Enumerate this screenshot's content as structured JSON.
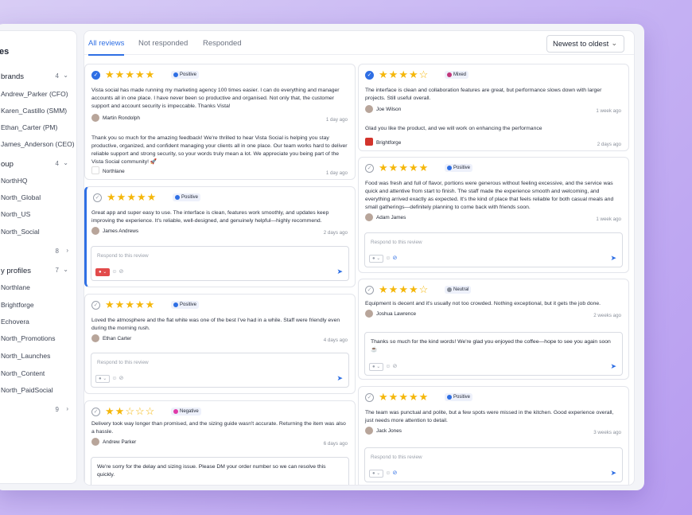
{
  "sidebar": {
    "title": "es",
    "rows": [
      {
        "label": "brands",
        "count": "4",
        "chev": "⌄",
        "head": true
      },
      {
        "label": "Andrew_Parker (CFO)"
      },
      {
        "label": "Karen_Castillo (SMM)"
      },
      {
        "label": "Ethan_Carter (PM)"
      },
      {
        "label": "James_Anderson (CEO)"
      },
      {
        "label": "oup",
        "count": "4",
        "chev": "⌄",
        "head": true
      },
      {
        "label": "NorthHQ"
      },
      {
        "label": "North_Global"
      },
      {
        "label": "North_US"
      },
      {
        "label": "North_Social"
      },
      {
        "label": "",
        "count": "8",
        "chev": "›",
        "head": true
      },
      {
        "label": "y profiles",
        "count": "7",
        "chev": "⌄",
        "head": true
      },
      {
        "label": "Northlane"
      },
      {
        "label": "Brightforge"
      },
      {
        "label": "Echovera"
      },
      {
        "label": "North_Promotions"
      },
      {
        "label": "North_Launches"
      },
      {
        "label": "North_Content"
      },
      {
        "label": "North_PaidSocial"
      },
      {
        "label": "",
        "count": "9",
        "chev": "›",
        "head": true
      }
    ]
  },
  "tabs": [
    "All reviews",
    "Not responded",
    "Responded"
  ],
  "sort": {
    "label": "Newest to oldest",
    "chev": "⌄"
  },
  "reply_placeholder": "Respond to this review",
  "cards": {
    "c1": {
      "stars": 5,
      "sentiment": "Positive",
      "sentiment_color": "#2f6fe4",
      "text": "Vista social has made running my marketing agency 100 times easier. I can do everything and manager accounts all in one place. I have never been so productive and organised. Not only that, the customer support and account security is impeccable. Thanks Vista!",
      "author": "Martin Rondolph",
      "time": "1 day ago",
      "reply": "Thank you so much for the amazing feedback! We're thrilled to hear Vista Social is helping you stay productive, organized, and confident managing your clients all in one place. Our team works hard to deliver reliable support and strong security, so your words truly mean a lot. We appreciate you being part of the Vista Social community! 🚀",
      "reply_author": "Northlane",
      "reply_time": "1 day ago"
    },
    "c2": {
      "stars": 5,
      "sentiment": "Positive",
      "sentiment_color": "#2f6fe4",
      "text": "Great app and super easy to use. The interface is clean, features work smoothly, and updates keep improving the experience. It's reliable, well-designed, and genuinely helpful—highly recommend.",
      "author": "James Andrews",
      "time": "2 days ago"
    },
    "c3": {
      "stars": 5,
      "sentiment": "Positive",
      "sentiment_color": "#2f6fe4",
      "text": "Loved the atmosphere and the flat white was one of the best I've had in a while. Staff were friendly even during the morning rush.",
      "author": "Ethan Carter",
      "time": "4 days ago"
    },
    "c4": {
      "stars": 2,
      "sentiment": "Negative",
      "sentiment_color": "#e03aa8",
      "text": "Delivery took way longer than promised, and the sizing guide wasn't accurate. Returning the item was also a hassle.",
      "author": "Andrew Parker",
      "time": "6 days ago",
      "reply_value": "We're sorry for the delay and sizing issue. Please DM your order number so we can resolve this quickly."
    },
    "c5": {
      "stars": 4,
      "sentiment": "Mixed",
      "sentiment_color": "#c2367a",
      "text": "The interface is clean and collaboration features are great, but performance slows down with larger projects. Still useful overall.",
      "author": "Joe Wilson",
      "time": "1 week ago",
      "reply": "Glad you like the product, and we will work on enhancing the performance",
      "reply_author": "Brightforge",
      "reply_time": "2 days ago"
    },
    "c6": {
      "stars": 5,
      "sentiment": "Positive",
      "sentiment_color": "#2f6fe4",
      "text": "Food was fresh and full of flavor, portions were generous without feeling excessive, and the service was quick and attentive from start to finish. The staff made the experience smooth and welcoming, and everything arrived exactly as expected. It's the kind of place that feels reliable for both casual meals and small gatherings—definitely planning to come back with friends soon.",
      "author": "Adam James",
      "time": "1 week ago"
    },
    "c7": {
      "stars": 4,
      "sentiment": "Neutral",
      "sentiment_color": "#8a909b",
      "text": "Equipment is decent and it's usually not too crowded. Nothing exceptional, but it gets the job done.",
      "author": "Joshua Lawrence",
      "time": "2 weeks ago",
      "reply_value": "Thanks so much for the kind words! We're glad you enjoyed the coffee—hope to see you again soon ☕"
    },
    "c8": {
      "stars": 5,
      "sentiment": "Positive",
      "sentiment_color": "#2f6fe4",
      "text": "The team was punctual and polite, but a few spots were missed in the kitchen. Good experience overall, just needs more attention to detail.",
      "author": "Jack Jones",
      "time": "3 weeks ago"
    }
  },
  "colors": {
    "accent": "#2f6fe4",
    "star": "#f5b70a",
    "danger": "#e24b4b"
  },
  "icons": {
    "check": "✓",
    "send": "➤",
    "emoji": "☺",
    "link": "🔗"
  }
}
